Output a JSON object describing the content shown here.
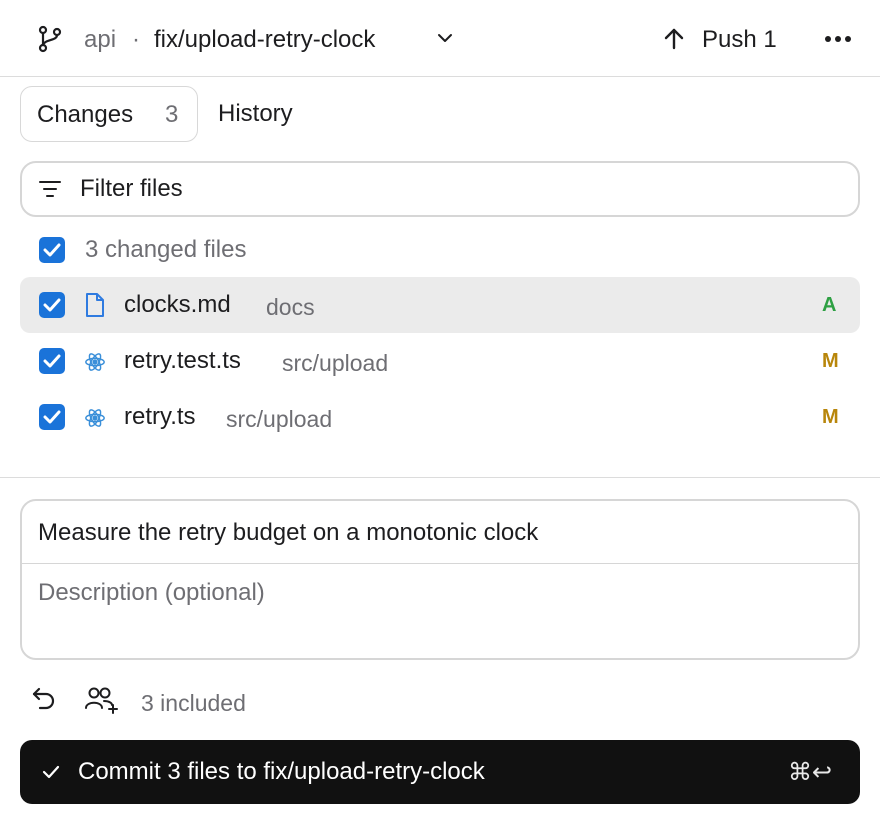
{
  "header": {
    "repo": "api",
    "separator": "·",
    "branch": "fix/upload-retry-clock",
    "push_label": "Push 1"
  },
  "tabs": {
    "changes_label": "Changes",
    "changes_count": "3",
    "history_label": "History"
  },
  "filter": {
    "placeholder": "Filter files"
  },
  "changes": {
    "select_all_label": "3 changed files",
    "files": [
      {
        "name": "clocks.md",
        "dir": "docs",
        "status": "A",
        "status_color": "#2ea043",
        "icon": "file-icon",
        "checked": true,
        "selected": true
      },
      {
        "name": "retry.test.ts",
        "dir": "src/upload",
        "status": "M",
        "status_color": "#b8860b",
        "icon": "react-icon",
        "checked": true,
        "selected": false
      },
      {
        "name": "retry.ts",
        "dir": "src/upload",
        "status": "M",
        "status_color": "#b8860b",
        "icon": "react-icon",
        "checked": true,
        "selected": false
      }
    ]
  },
  "commit": {
    "summary": "Measure the retry budget on a monotonic clock",
    "description_placeholder": "Description (optional)",
    "included_label": "3 included",
    "button_label": "Commit 3 files to fix/upload-retry-clock",
    "shortcut": "⌘↩"
  },
  "colors": {
    "accent": "#1a73d9",
    "commit_button": "#111111"
  }
}
